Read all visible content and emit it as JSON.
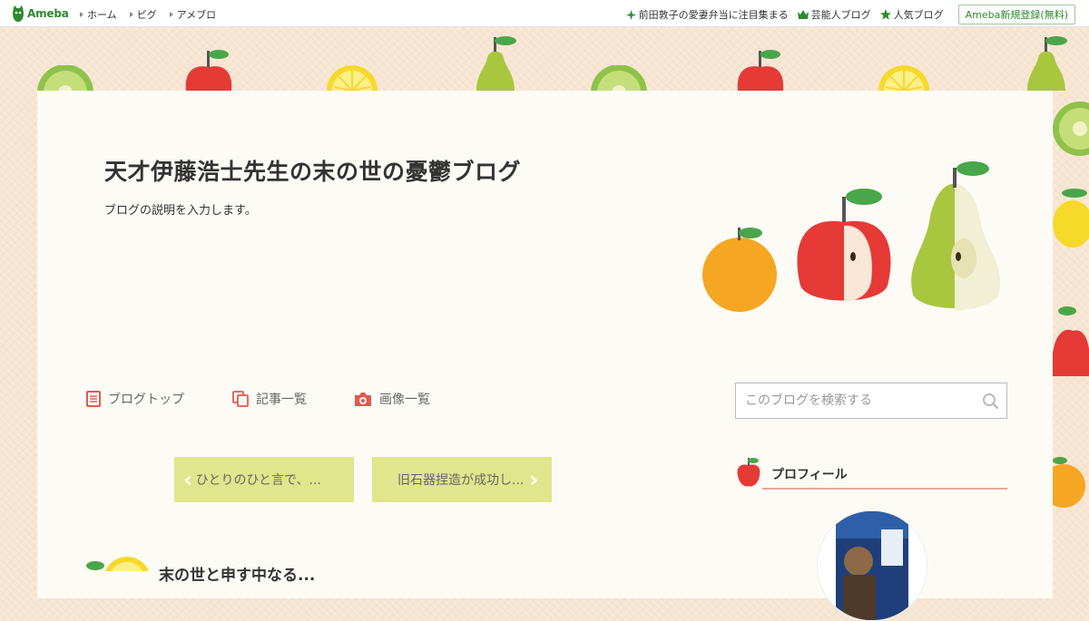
{
  "topbar": {
    "logo_text": "Ameba",
    "nav": [
      "ホーム",
      "ピグ",
      "アメブロ"
    ],
    "links": [
      {
        "label": "前田敦子の愛妻弁当に注目集まる",
        "icon": "sparkle-icon"
      },
      {
        "label": "芸能人ブログ",
        "icon": "crown-icon"
      },
      {
        "label": "人気ブログ",
        "icon": "star-icon"
      }
    ],
    "signup": "Ameba新規登録(無料)"
  },
  "blog": {
    "title": "天才伊藤浩士先生の末の世の憂鬱ブログ",
    "description": "ブログの説明を入力します。"
  },
  "blognav": [
    {
      "label": "ブログトップ",
      "icon": "document-icon"
    },
    {
      "label": "記事一覧",
      "icon": "copy-icon"
    },
    {
      "label": "画像一覧",
      "icon": "camera-icon"
    }
  ],
  "search": {
    "placeholder": "このブログを検索する"
  },
  "pager": {
    "prev": "ひとりのひと言で、...",
    "next": "旧石器捏造が成功し..."
  },
  "profile": {
    "heading": "プロフィール"
  },
  "post": {
    "title": "末の世と申す中なる..."
  },
  "colors": {
    "accent_green": "#2d8a2d",
    "pager_bg": "#dfe68c",
    "profile_line": "#e9a6a0",
    "apple_red": "#e53a36"
  }
}
